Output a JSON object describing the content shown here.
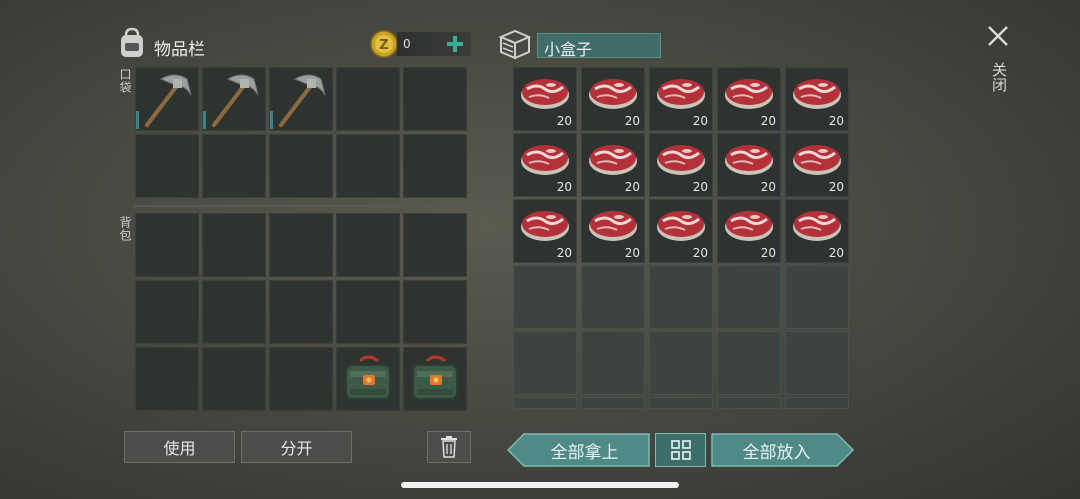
{
  "inventory": {
    "title": "物品栏",
    "icon": "backpack-icon",
    "coins": "0",
    "coin_icon": "coin-icon",
    "add_icon": "plus-icon",
    "pocket_label": "口袋",
    "backpack_label": "背包",
    "pocket_items": [
      "pickaxe",
      "pickaxe",
      "pickaxe",
      "",
      "",
      "",
      "",
      "",
      "",
      ""
    ],
    "backpack_items": [
      "",
      "",
      "",
      "",
      "",
      "",
      "",
      "",
      "",
      "",
      "",
      "",
      "",
      "backpack-case",
      "backpack-case"
    ]
  },
  "container": {
    "title": "小盒子",
    "icon": "box-icon",
    "items": [
      {
        "item": "meat",
        "qty": "20"
      },
      {
        "item": "meat",
        "qty": "20"
      },
      {
        "item": "meat",
        "qty": "20"
      },
      {
        "item": "meat",
        "qty": "20"
      },
      {
        "item": "meat",
        "qty": "20"
      },
      {
        "item": "meat",
        "qty": "20"
      },
      {
        "item": "meat",
        "qty": "20"
      },
      {
        "item": "meat",
        "qty": "20"
      },
      {
        "item": "meat",
        "qty": "20"
      },
      {
        "item": "meat",
        "qty": "20"
      },
      {
        "item": "meat",
        "qty": "20"
      },
      {
        "item": "meat",
        "qty": "20"
      },
      {
        "item": "meat",
        "qty": "20"
      },
      {
        "item": "meat",
        "qty": "20"
      },
      {
        "item": "meat",
        "qty": "20"
      }
    ]
  },
  "buttons": {
    "use": "使用",
    "split": "分开",
    "trash_icon": "trash-icon",
    "take_all": "全部拿上",
    "sort_icon": "grid-sort-icon",
    "put_all": "全部放入"
  },
  "close": {
    "icon": "close-icon",
    "label": "关闭"
  },
  "colors": {
    "teal_button": "#4f8a86",
    "teal_border": "#7fb9b3",
    "name_field": "#3f6c68"
  }
}
